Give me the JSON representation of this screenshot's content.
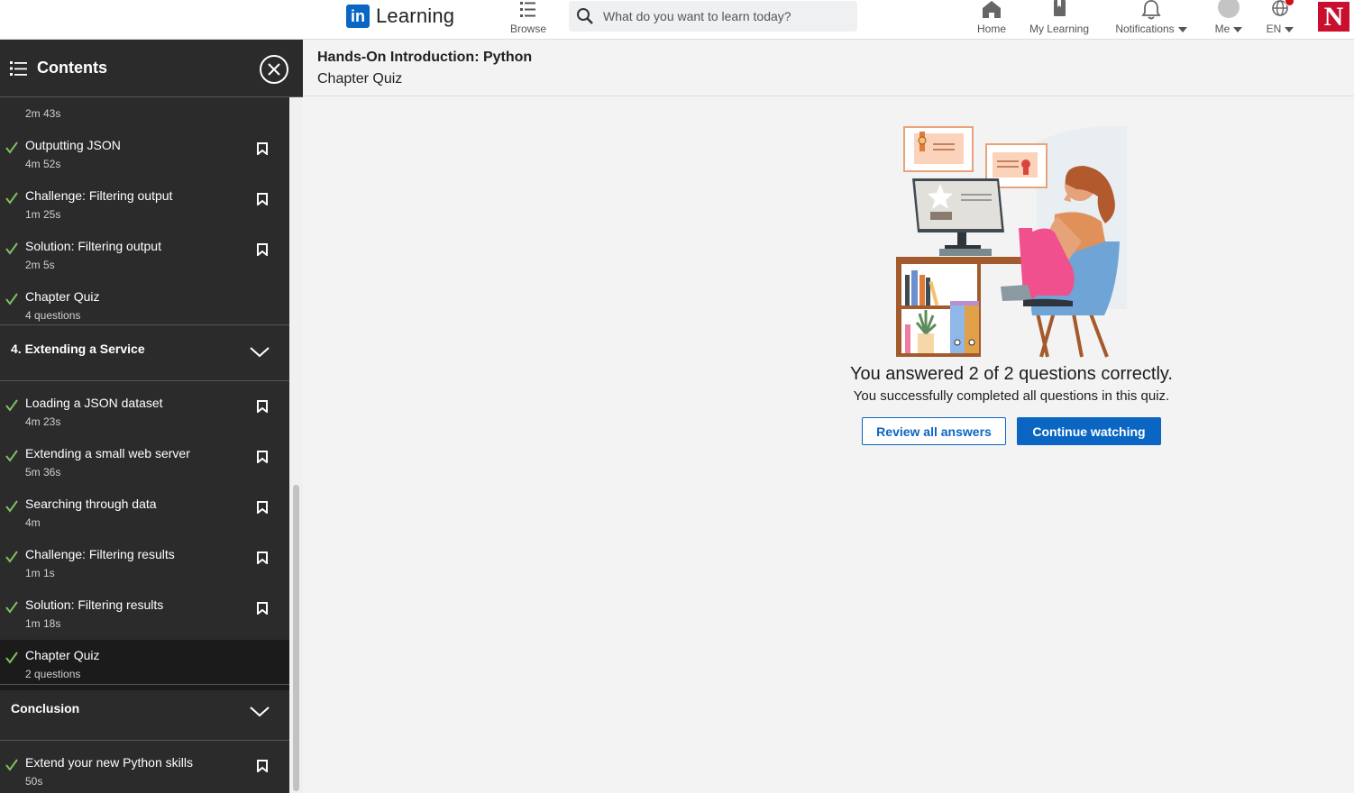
{
  "topnav": {
    "logo_badge": "in",
    "logo_text": "Learning",
    "browse_label": "Browse",
    "search_placeholder": "What do you want to learn today?",
    "home_label": "Home",
    "my_learning_label": "My Learning",
    "notifications_label": "Notifications",
    "me_label": "Me",
    "language_label": "EN",
    "institution_logo": "N"
  },
  "sidebar": {
    "title": "Contents",
    "items_top": [
      {
        "title": "",
        "meta": "2m 43s"
      },
      {
        "title": "Outputting JSON",
        "meta": "4m 52s"
      },
      {
        "title": "Challenge: Filtering output",
        "meta": "1m 25s"
      },
      {
        "title": "Solution: Filtering output",
        "meta": "2m 5s"
      },
      {
        "title": "Chapter Quiz",
        "meta": "4 questions"
      }
    ],
    "chapter4": "4. Extending a Service",
    "items_ch4": [
      {
        "title": "Loading a JSON dataset",
        "meta": "4m 23s"
      },
      {
        "title": "Extending a small web server",
        "meta": "5m 36s"
      },
      {
        "title": "Searching through data",
        "meta": "4m"
      },
      {
        "title": "Challenge: Filtering results",
        "meta": "1m 1s"
      },
      {
        "title": "Solution: Filtering results",
        "meta": "1m 18s"
      },
      {
        "title": "Chapter Quiz",
        "meta": "2 questions"
      }
    ],
    "conclusion": "Conclusion",
    "items_conclusion": [
      {
        "title": "Extend your new Python skills",
        "meta": "50s"
      }
    ]
  },
  "main": {
    "course_title": "Hands-On Introduction: Python",
    "section_title": "Chapter Quiz",
    "result_text": "You answered 2 of 2 questions correctly.",
    "result_sub": "You successfully completed all questions in this quiz.",
    "review_button": "Review all answers",
    "continue_button": "Continue watching"
  },
  "colors": {
    "accent": "#0a66c2",
    "check": "#7fc15e",
    "sidebar_bg": "#2b2b2b",
    "notification_badge": "#cc1016",
    "institution": "#c8102e"
  }
}
